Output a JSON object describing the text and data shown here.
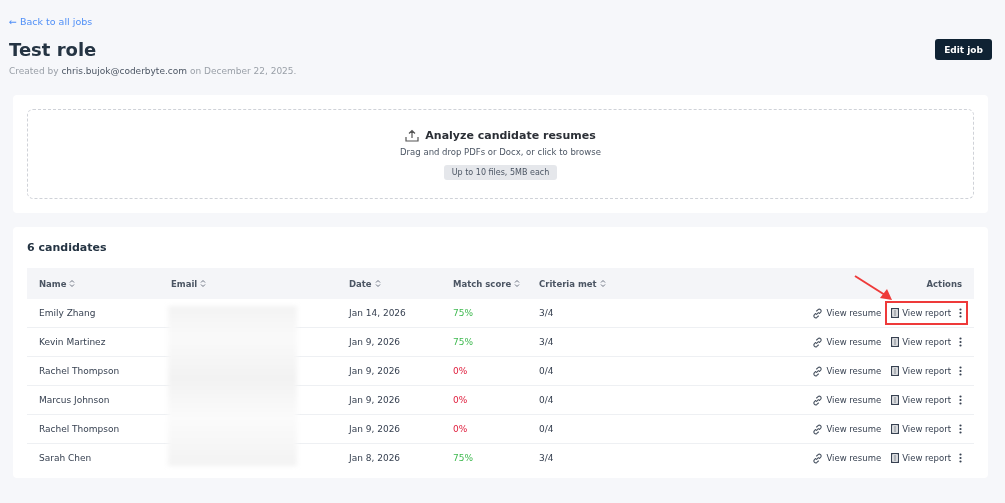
{
  "back_link": "← Back to all jobs",
  "title": "Test role",
  "meta": {
    "prefix": "Created by",
    "email": "chris.bujok@coderbyte.com",
    "suffix": "on December 22, 2025."
  },
  "edit_button": "Edit job",
  "upload": {
    "title": "Analyze candidate resumes",
    "hint": "Drag and drop PDFs or Docx, or click to browse",
    "limit": "Up to 10 files, 5MB each"
  },
  "candidates": {
    "heading": "6 candidates",
    "columns": [
      {
        "label": "Name",
        "sortable": true
      },
      {
        "label": "Email",
        "sortable": true
      },
      {
        "label": "Date",
        "sortable": true
      },
      {
        "label": "Match score",
        "sortable": true
      },
      {
        "label": "Criteria met",
        "sortable": true
      },
      {
        "label": "Actions",
        "sortable": false
      }
    ],
    "rows": [
      {
        "name": "Emily Zhang",
        "date": "Jan 14, 2026",
        "score": "75%",
        "passed": true,
        "criteria": "3/4",
        "resume": "View resume",
        "report": "View report",
        "highlighted": true
      },
      {
        "name": "Kevin Martinez",
        "date": "Jan 9, 2026",
        "score": "75%",
        "passed": true,
        "criteria": "3/4",
        "resume": "View resume",
        "report": "View report",
        "highlighted": false
      },
      {
        "name": "Rachel Thompson",
        "date": "Jan 9, 2026",
        "score": "0%",
        "passed": false,
        "criteria": "0/4",
        "resume": "View resume",
        "report": "View report",
        "highlighted": false
      },
      {
        "name": "Marcus Johnson",
        "date": "Jan 9, 2026",
        "score": "0%",
        "passed": false,
        "criteria": "0/4",
        "resume": "View resume",
        "report": "View report",
        "highlighted": false
      },
      {
        "name": "Rachel Thompson",
        "date": "Jan 9, 2026",
        "score": "0%",
        "passed": false,
        "criteria": "0/4",
        "resume": "View resume",
        "report": "View report",
        "highlighted": false
      },
      {
        "name": "Sarah Chen",
        "date": "Jan 8, 2026",
        "score": "75%",
        "passed": true,
        "criteria": "3/4",
        "resume": "View resume",
        "report": "View report",
        "highlighted": false
      }
    ]
  }
}
